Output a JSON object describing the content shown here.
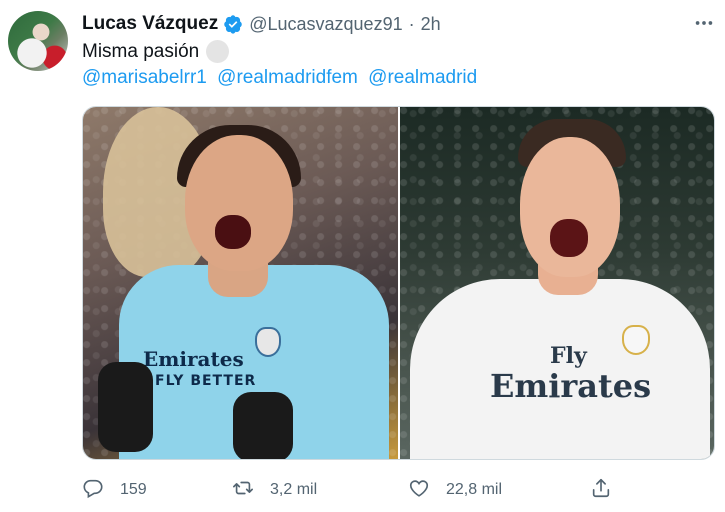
{
  "tweet": {
    "author_name": "Lucas Vázquez",
    "handle": "@Lucasvazquez91",
    "separator": "·",
    "time": "2h",
    "text": "Misma pasión",
    "mentions": [
      "@marisabelrr1",
      "@realmadridfem",
      "@realmadrid"
    ]
  },
  "media": {
    "left_sponsor_line1": "Emirates",
    "left_sponsor_line2": "FLY BETTER",
    "right_sponsor_line1": "Fly",
    "right_sponsor_line2": "Emirates"
  },
  "actions": {
    "reply_count": "159",
    "retweet_count": "3,2 mil",
    "like_count": "22,8 mil"
  },
  "colors": {
    "accent": "#1d9bf0",
    "muted_text": "#536471",
    "text": "#0f1419"
  },
  "icons": {
    "verified": "verified-badge-icon",
    "more": "more-horizontal-icon",
    "reply": "reply-icon",
    "retweet": "retweet-icon",
    "like": "heart-icon",
    "share": "share-icon"
  }
}
